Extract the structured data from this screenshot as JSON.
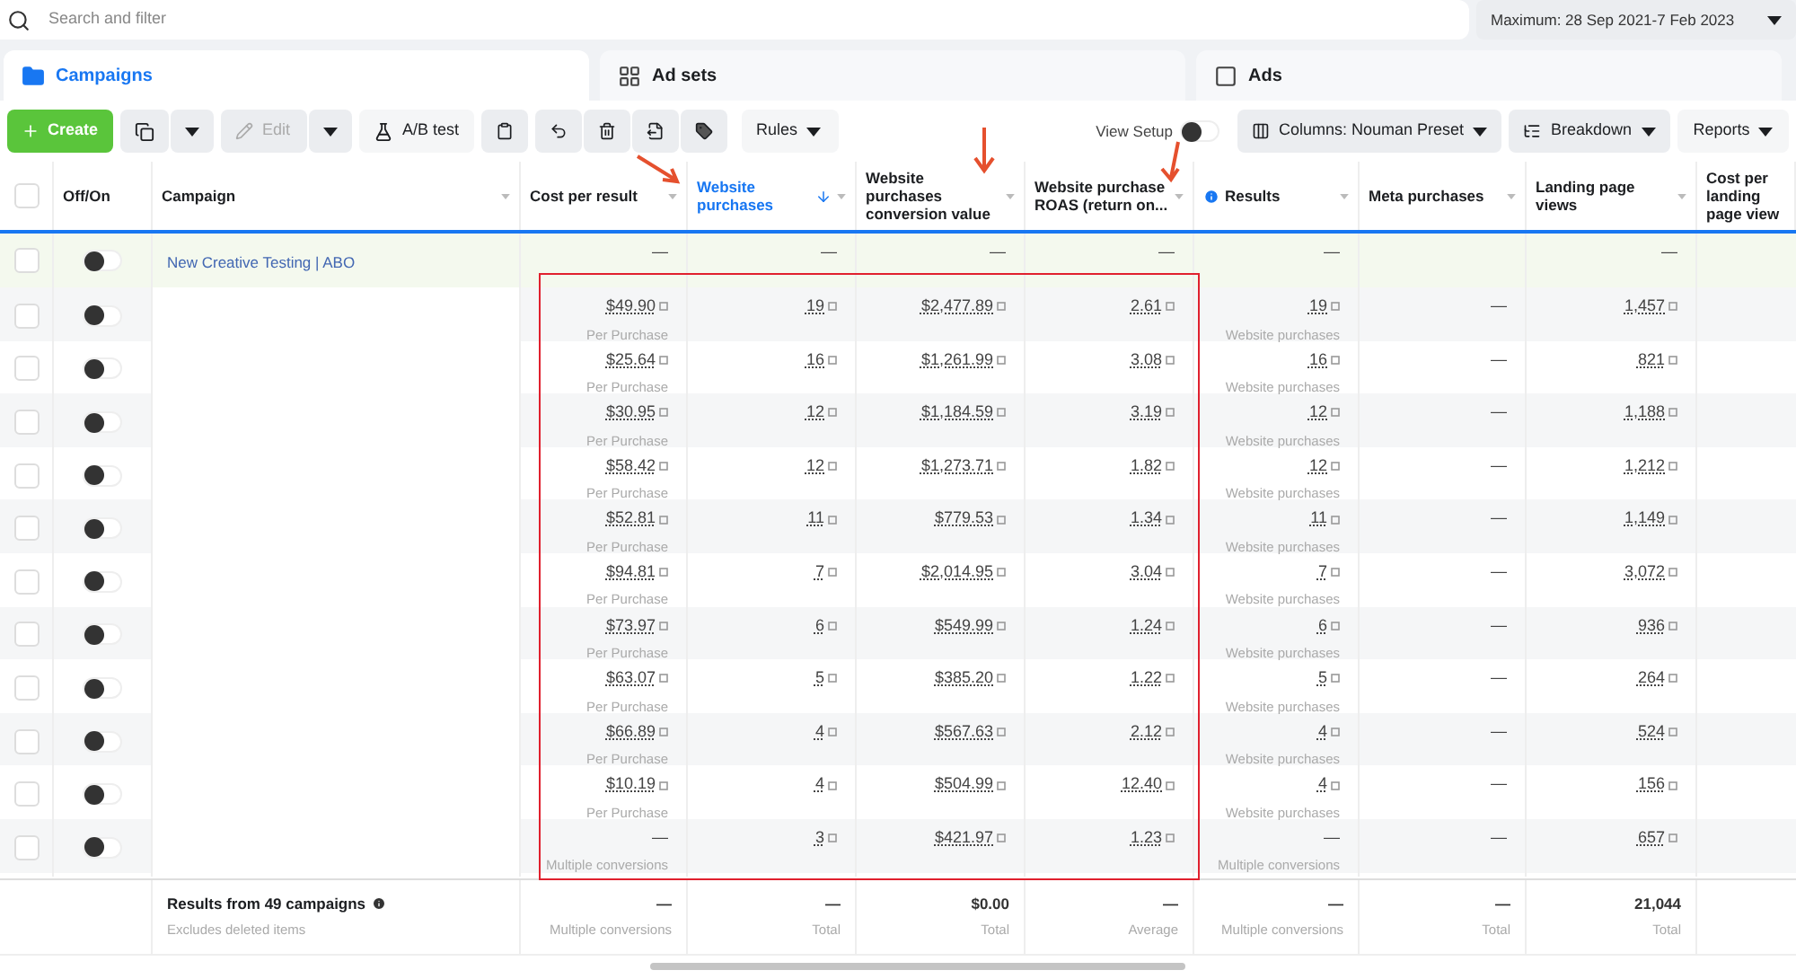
{
  "search": {
    "placeholder": "Search and filter"
  },
  "date_range": "Maximum: 28 Sep 2021-7 Feb 2023",
  "tabs": [
    {
      "label": "Campaigns",
      "selected": true
    },
    {
      "label": "Ad sets",
      "selected": false
    },
    {
      "label": "Ads",
      "selected": false
    }
  ],
  "toolbar": {
    "create": "Create",
    "edit": {
      "label": "Edit",
      "disabled": true
    },
    "ab_test": "A/B test",
    "rules": "Rules",
    "view_setup": {
      "label": "View Setup",
      "on": false
    },
    "columns": "Columns: Nouman Preset",
    "breakdown": "Breakdown",
    "reports": "Reports"
  },
  "table": {
    "select_all": {
      "checked": false
    },
    "fixed_columns": [
      {
        "label": "Off/On",
        "menu": false
      },
      {
        "label": "Campaign",
        "menu": true
      }
    ],
    "columns": [
      {
        "label": "Cost per result",
        "sorted": false,
        "info": false,
        "menu": true
      },
      {
        "label": "Website purchases",
        "sorted": true,
        "info": false,
        "menu": true
      },
      {
        "label": "Website purchases conversion value",
        "sorted": false,
        "info": false,
        "menu": true
      },
      {
        "label": "Website purchase ROAS (return on...",
        "sorted": false,
        "info": false,
        "menu": true
      },
      {
        "label": "Results",
        "sorted": false,
        "info": true,
        "menu": true
      },
      {
        "label": "Meta purchases",
        "sorted": false,
        "info": false,
        "menu": true
      },
      {
        "label": "Landing page views",
        "sorted": false,
        "info": false,
        "menu": true
      },
      {
        "label": "Cost per landing page view",
        "sorted": false,
        "info": false,
        "menu": false
      }
    ],
    "rows": [
      {
        "kind": "group",
        "name": "New Creative Testing | ABO",
        "on": false,
        "checked": false,
        "cells": [
          {
            "value": "—",
            "link": false
          },
          {
            "value": "—",
            "link": false
          },
          {
            "value": "—",
            "link": false
          },
          {
            "value": "—",
            "link": false
          },
          {
            "value": "—",
            "link": false
          },
          null,
          {
            "value": "—",
            "link": false
          }
        ]
      },
      {
        "kind": "campaign",
        "on": false,
        "checked": false,
        "cells": [
          {
            "value": "$49.90",
            "note": "Per Purchase",
            "link": true
          },
          {
            "value": "19",
            "link": true
          },
          {
            "value": "$2,477.89",
            "link": true
          },
          {
            "value": "2.61",
            "link": true
          },
          {
            "value": "19",
            "note": "Website purchases",
            "link": true
          },
          {
            "value": "—",
            "link": false
          },
          {
            "value": "1,457",
            "link": true
          }
        ]
      },
      {
        "kind": "campaign",
        "on": false,
        "checked": false,
        "cells": [
          {
            "value": "$25.64",
            "note": "Per Purchase",
            "link": true
          },
          {
            "value": "16",
            "link": true
          },
          {
            "value": "$1,261.99",
            "link": true
          },
          {
            "value": "3.08",
            "link": true
          },
          {
            "value": "16",
            "note": "Website purchases",
            "link": true
          },
          {
            "value": "—",
            "link": false
          },
          {
            "value": "821",
            "link": true
          }
        ]
      },
      {
        "kind": "campaign",
        "on": false,
        "checked": false,
        "cells": [
          {
            "value": "$30.95",
            "note": "Per Purchase",
            "link": true
          },
          {
            "value": "12",
            "link": true
          },
          {
            "value": "$1,184.59",
            "link": true
          },
          {
            "value": "3.19",
            "link": true
          },
          {
            "value": "12",
            "note": "Website purchases",
            "link": true
          },
          {
            "value": "—",
            "link": false
          },
          {
            "value": "1,188",
            "link": true
          }
        ]
      },
      {
        "kind": "campaign",
        "on": false,
        "checked": false,
        "cells": [
          {
            "value": "$58.42",
            "note": "Per Purchase",
            "link": true
          },
          {
            "value": "12",
            "link": true
          },
          {
            "value": "$1,273.71",
            "link": true
          },
          {
            "value": "1.82",
            "link": true
          },
          {
            "value": "12",
            "note": "Website purchases",
            "link": true
          },
          {
            "value": "—",
            "link": false
          },
          {
            "value": "1,212",
            "link": true
          }
        ]
      },
      {
        "kind": "campaign",
        "on": false,
        "checked": false,
        "cells": [
          {
            "value": "$52.81",
            "note": "Per Purchase",
            "link": true
          },
          {
            "value": "11",
            "link": true
          },
          {
            "value": "$779.53",
            "link": true
          },
          {
            "value": "1.34",
            "link": true
          },
          {
            "value": "11",
            "note": "Website purchases",
            "link": true
          },
          {
            "value": "—",
            "link": false
          },
          {
            "value": "1,149",
            "link": true
          }
        ]
      },
      {
        "kind": "campaign",
        "on": false,
        "checked": false,
        "cells": [
          {
            "value": "$94.81",
            "note": "Per Purchase",
            "link": true
          },
          {
            "value": "7",
            "link": true
          },
          {
            "value": "$2,014.95",
            "link": true
          },
          {
            "value": "3.04",
            "link": true
          },
          {
            "value": "7",
            "note": "Website purchases",
            "link": true
          },
          {
            "value": "—",
            "link": false
          },
          {
            "value": "3,072",
            "link": true
          }
        ]
      },
      {
        "kind": "campaign",
        "on": false,
        "checked": false,
        "cells": [
          {
            "value": "$73.97",
            "note": "Per Purchase",
            "link": true
          },
          {
            "value": "6",
            "link": true
          },
          {
            "value": "$549.99",
            "link": true
          },
          {
            "value": "1.24",
            "link": true
          },
          {
            "value": "6",
            "note": "Website purchases",
            "link": true
          },
          {
            "value": "—",
            "link": false
          },
          {
            "value": "936",
            "link": true
          }
        ]
      },
      {
        "kind": "campaign",
        "on": false,
        "checked": false,
        "cells": [
          {
            "value": "$63.07",
            "note": "Per Purchase",
            "link": true
          },
          {
            "value": "5",
            "link": true
          },
          {
            "value": "$385.20",
            "link": true
          },
          {
            "value": "1.22",
            "link": true
          },
          {
            "value": "5",
            "note": "Website purchases",
            "link": true
          },
          {
            "value": "—",
            "link": false
          },
          {
            "value": "264",
            "link": true
          }
        ]
      },
      {
        "kind": "campaign",
        "on": false,
        "checked": false,
        "cells": [
          {
            "value": "$66.89",
            "note": "Per Purchase",
            "link": true
          },
          {
            "value": "4",
            "link": true
          },
          {
            "value": "$567.63",
            "link": true
          },
          {
            "value": "2.12",
            "link": true
          },
          {
            "value": "4",
            "note": "Website purchases",
            "link": true
          },
          {
            "value": "—",
            "link": false
          },
          {
            "value": "524",
            "link": true
          }
        ]
      },
      {
        "kind": "campaign",
        "on": false,
        "checked": false,
        "cells": [
          {
            "value": "$10.19",
            "note": "Per Purchase",
            "link": true
          },
          {
            "value": "4",
            "link": true
          },
          {
            "value": "$504.99",
            "link": true
          },
          {
            "value": "12.40",
            "link": true
          },
          {
            "value": "4",
            "note": "Website purchases",
            "link": true
          },
          {
            "value": "—",
            "link": false
          },
          {
            "value": "156",
            "link": true
          }
        ]
      },
      {
        "kind": "campaign",
        "on": false,
        "checked": false,
        "cells": [
          {
            "value": "—",
            "note": "Multiple conversions",
            "link": false
          },
          {
            "value": "3",
            "link": true
          },
          {
            "value": "$421.97",
            "link": true
          },
          {
            "value": "1.23",
            "link": true
          },
          {
            "value": "—",
            "note": "Multiple conversions",
            "link": false
          },
          {
            "value": "—",
            "link": false
          },
          {
            "value": "657",
            "link": true
          }
        ]
      }
    ],
    "footer": {
      "title": "Results from 49 campaigns",
      "note": "Excludes deleted items",
      "cells": [
        {
          "value": "—",
          "note": "Multiple conversions"
        },
        {
          "value": "—",
          "note": "Total"
        },
        {
          "value": "$0.00",
          "note": "Total"
        },
        {
          "value": "—",
          "note": "Average"
        },
        {
          "value": "—",
          "note": "Multiple conversions"
        },
        {
          "value": "—",
          "note": "Total"
        },
        {
          "value": "21,044",
          "note": "Total"
        }
      ]
    }
  }
}
